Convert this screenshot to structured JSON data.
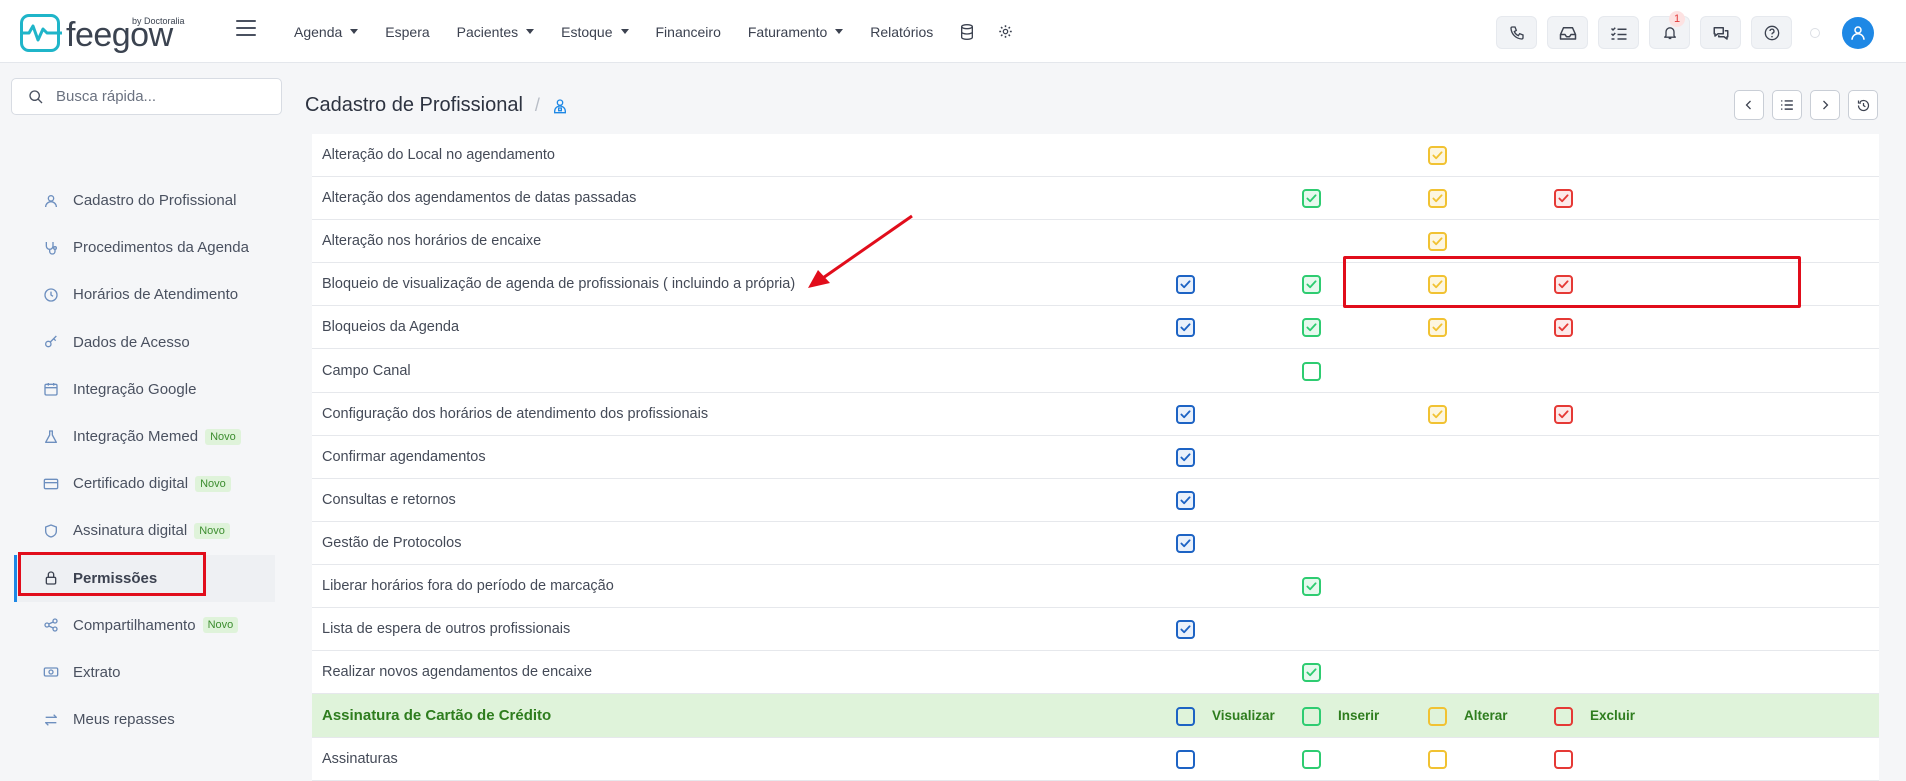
{
  "brand": {
    "name": "feegow",
    "by": "by Doctoralia"
  },
  "nav": {
    "items": [
      {
        "label": "Agenda",
        "dropdown": true
      },
      {
        "label": "Espera",
        "dropdown": false
      },
      {
        "label": "Pacientes",
        "dropdown": true
      },
      {
        "label": "Estoque",
        "dropdown": true
      },
      {
        "label": "Financeiro",
        "dropdown": false
      },
      {
        "label": "Faturamento",
        "dropdown": true
      },
      {
        "label": "Relatórios",
        "dropdown": false
      }
    ],
    "notifications_count": "1"
  },
  "search": {
    "placeholder": "Busca rápida..."
  },
  "sidebar": {
    "items": [
      {
        "label": "Cadastro do Profissional",
        "icon": "user-icon",
        "badge": ""
      },
      {
        "label": "Procedimentos da Agenda",
        "icon": "stethoscope-icon",
        "badge": ""
      },
      {
        "label": "Horários de Atendimento",
        "icon": "clock-icon",
        "badge": ""
      },
      {
        "label": "Dados de Acesso",
        "icon": "key-icon",
        "badge": ""
      },
      {
        "label": "Integração Google",
        "icon": "calendar-icon",
        "badge": ""
      },
      {
        "label": "Integração Memed",
        "icon": "flask-icon",
        "badge": "Novo"
      },
      {
        "label": "Certificado digital",
        "icon": "card-icon",
        "badge": "Novo"
      },
      {
        "label": "Assinatura digital",
        "icon": "shield-icon",
        "badge": "Novo"
      },
      {
        "label": "Permissões",
        "icon": "lock-icon",
        "badge": "",
        "active": true
      },
      {
        "label": "Compartilhamento",
        "icon": "share-icon",
        "badge": "Novo"
      },
      {
        "label": "Extrato",
        "icon": "money-icon",
        "badge": ""
      },
      {
        "label": "Meus repasses",
        "icon": "transfer-icon",
        "badge": ""
      }
    ]
  },
  "page": {
    "title": "Cadastro de Profissional",
    "separator": "/"
  },
  "permissions": {
    "colors": {
      "visualizar": "#1d63c4",
      "inserir": "#2ecc71",
      "alterar": "#f1c232",
      "excluir": "#e53935"
    },
    "rows": [
      {
        "label": "Alteração do Local no agendamento",
        "cols": [
          null,
          null,
          true,
          null
        ]
      },
      {
        "label": "Alteração dos agendamentos de datas passadas",
        "cols": [
          null,
          true,
          true,
          true
        ]
      },
      {
        "label": "Alteração nos horários de encaixe",
        "cols": [
          null,
          null,
          true,
          null
        ]
      },
      {
        "label": "Bloqueio de visualização de agenda de profissionais ( incluindo a própria)",
        "cols": [
          true,
          true,
          true,
          true
        ]
      },
      {
        "label": "Bloqueios da Agenda",
        "cols": [
          true,
          true,
          true,
          true
        ]
      },
      {
        "label": "Campo Canal",
        "cols": [
          null,
          false,
          null,
          null
        ]
      },
      {
        "label": "Configuração dos horários de atendimento dos profissionais",
        "cols": [
          true,
          null,
          true,
          true
        ]
      },
      {
        "label": "Confirmar agendamentos",
        "cols": [
          true,
          null,
          null,
          null
        ]
      },
      {
        "label": "Consultas e retornos",
        "cols": [
          true,
          null,
          null,
          null
        ]
      },
      {
        "label": "Gestão de Protocolos",
        "cols": [
          true,
          null,
          null,
          null
        ]
      },
      {
        "label": "Liberar horários fora do período de marcação",
        "cols": [
          null,
          true,
          null,
          null
        ]
      },
      {
        "label": "Lista de espera de outros profissionais",
        "cols": [
          true,
          null,
          null,
          null
        ]
      },
      {
        "label": "Realizar novos agendamentos de encaixe",
        "cols": [
          null,
          true,
          null,
          null
        ]
      }
    ],
    "group": {
      "label": "Assinatura de Cartão de Crédito",
      "col_labels": [
        "Visualizar",
        "Inserir",
        "Alterar",
        "Excluir"
      ]
    },
    "group_rows": [
      {
        "label": "Assinaturas",
        "cols": [
          false,
          false,
          false,
          false
        ]
      }
    ]
  }
}
